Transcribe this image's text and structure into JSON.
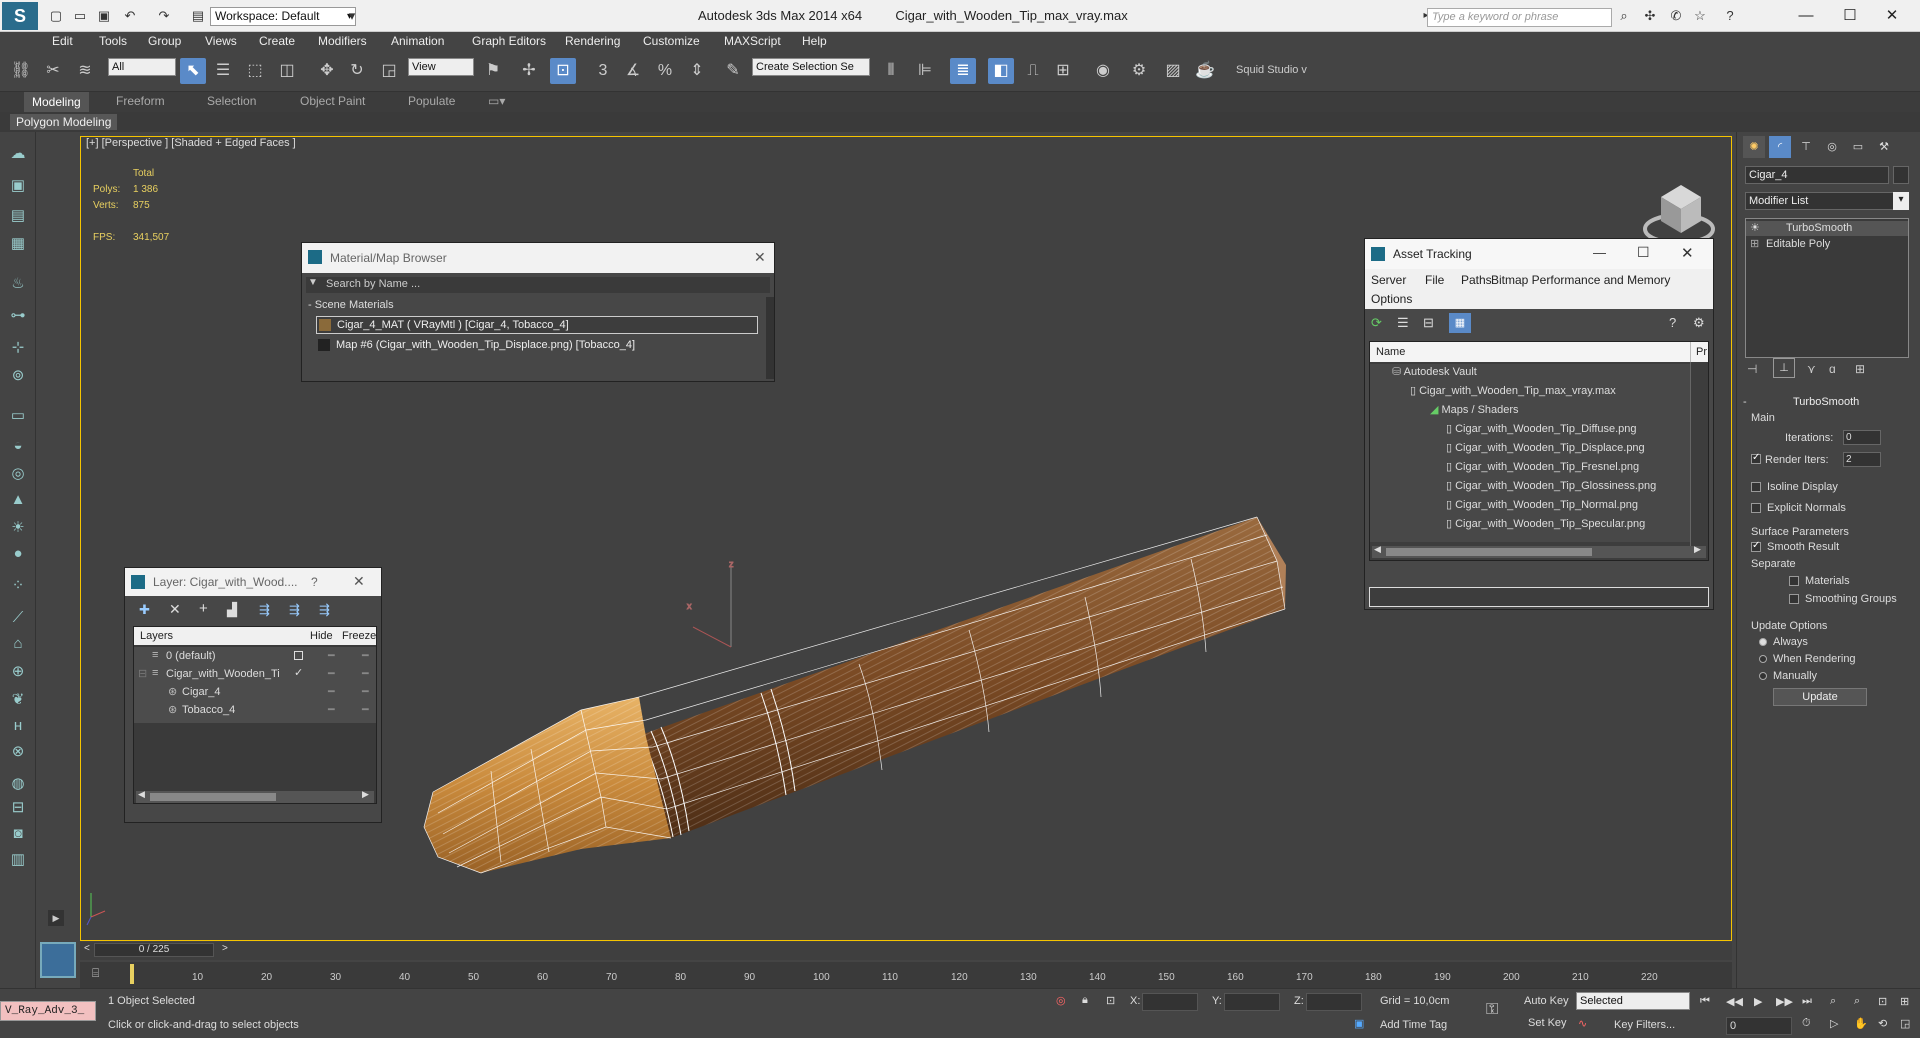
{
  "window": {
    "title_app": "Autodesk 3ds Max  2014 x64",
    "title_file": "Cigar_with_Wooden_Tip_max_vray.max",
    "workspace": "Workspace: Default",
    "search_placeholder": "Type a keyword or phrase"
  },
  "menu": [
    "Edit",
    "Tools",
    "Group",
    "Views",
    "Create",
    "Modifiers",
    "Animation",
    "Graph Editors",
    "Rendering",
    "Customize",
    "MAXScript",
    "Help"
  ],
  "toolbar": {
    "selection_filter": "All",
    "ref_coord": "View",
    "named_selection": "Create Selection Se",
    "squid": "Squid Studio v"
  },
  "ribbon": {
    "tabs": [
      "Modeling",
      "Freeform",
      "Selection",
      "Object Paint",
      "Populate"
    ],
    "active_tab": "Modeling",
    "panel": "Polygon Modeling"
  },
  "viewport": {
    "label": "[+] [Perspective ] [Shaded + Edged Faces ]",
    "stats": {
      "total_label": "Total",
      "polys_label": "Polys:",
      "polys": "1 386",
      "verts_label": "Verts:",
      "verts": "875",
      "fps_label": "FPS:",
      "fps": "341,507"
    },
    "axis_z": "z",
    "gizmo_x": "x"
  },
  "material_browser": {
    "title": "Material/Map Browser",
    "search_placeholder": "Search by Name ...",
    "section": "- Scene Materials",
    "items": [
      "Cigar_4_MAT  ( VRayMtl )  [Cigar_4, Tobacco_4]",
      "Map #6 (Cigar_with_Wooden_Tip_Displace.png) [Tobacco_4]"
    ]
  },
  "layer_window": {
    "title": "Layer: Cigar_with_Wood....",
    "help": "?",
    "columns": [
      "Layers",
      "Hide",
      "Freeze"
    ],
    "rows": [
      {
        "label": "0 (default)",
        "indent": 0
      },
      {
        "label": "Cigar_with_Wooden_Ti",
        "indent": 0
      },
      {
        "label": "Cigar_4",
        "indent": 1
      },
      {
        "label": "Tobacco_4",
        "indent": 1
      }
    ]
  },
  "asset_tracking": {
    "title": "Asset Tracking",
    "menu": [
      "Server",
      "File",
      "Paths",
      "Bitmap Performance and Memory",
      "Options"
    ],
    "col_name": "Name",
    "col_pr": "Pr",
    "tree": [
      {
        "label": "Autodesk Vault",
        "level": 0
      },
      {
        "label": "Cigar_with_Wooden_Tip_max_vray.max",
        "level": 1
      },
      {
        "label": "Maps / Shaders",
        "level": 2
      },
      {
        "label": "Cigar_with_Wooden_Tip_Diffuse.png",
        "level": 3
      },
      {
        "label": "Cigar_with_Wooden_Tip_Displace.png",
        "level": 3
      },
      {
        "label": "Cigar_with_Wooden_Tip_Fresnel.png",
        "level": 3
      },
      {
        "label": "Cigar_with_Wooden_Tip_Glossiness.png",
        "level": 3
      },
      {
        "label": "Cigar_with_Wooden_Tip_Normal.png",
        "level": 3
      },
      {
        "label": "Cigar_with_Wooden_Tip_Specular.png",
        "level": 3
      }
    ]
  },
  "command_panel": {
    "object_name": "Cigar_4",
    "modifier_list": "Modifier List",
    "stack": [
      "TurboSmooth",
      "Editable Poly"
    ],
    "rollout_title": "TurboSmooth",
    "main_label": "Main",
    "iterations_label": "Iterations:",
    "iterations": "0",
    "render_iters_label": "Render Iters:",
    "render_iters": "2",
    "isoline": "Isoline Display",
    "explicit": "Explicit Normals",
    "surface_params": "Surface Parameters",
    "smooth_result": "Smooth Result",
    "separate": "Separate",
    "materials": "Materials",
    "smoothing_groups": "Smoothing Groups",
    "update_options": "Update Options",
    "always": "Always",
    "when_rendering": "When Rendering",
    "manually": "Manually",
    "update_btn": "Update"
  },
  "timeline": {
    "frame": "0 / 225",
    "ticks": [
      "10",
      "20",
      "30",
      "40",
      "50",
      "60",
      "70",
      "80",
      "90",
      "100",
      "110",
      "120",
      "130",
      "140",
      "150",
      "160",
      "170",
      "180",
      "190",
      "200",
      "210",
      "220"
    ]
  },
  "status": {
    "script_field": "V_Ray_Adv_3_",
    "selected": "1 Object Selected",
    "hint": "Click or click-and-drag to select objects",
    "x_label": "X:",
    "y_label": "Y:",
    "z_label": "Z:",
    "grid": "Grid = 10,0cm",
    "add_time_tag": "Add Time Tag",
    "auto_key": "Auto Key",
    "set_key": "Set Key",
    "key_mode": "Selected",
    "key_filters": "Key Filters...",
    "current_frame": "0"
  },
  "colors": {
    "viewport_border": "#f5c400",
    "accent": "#5a8ac8",
    "stats": "#e8d060"
  }
}
